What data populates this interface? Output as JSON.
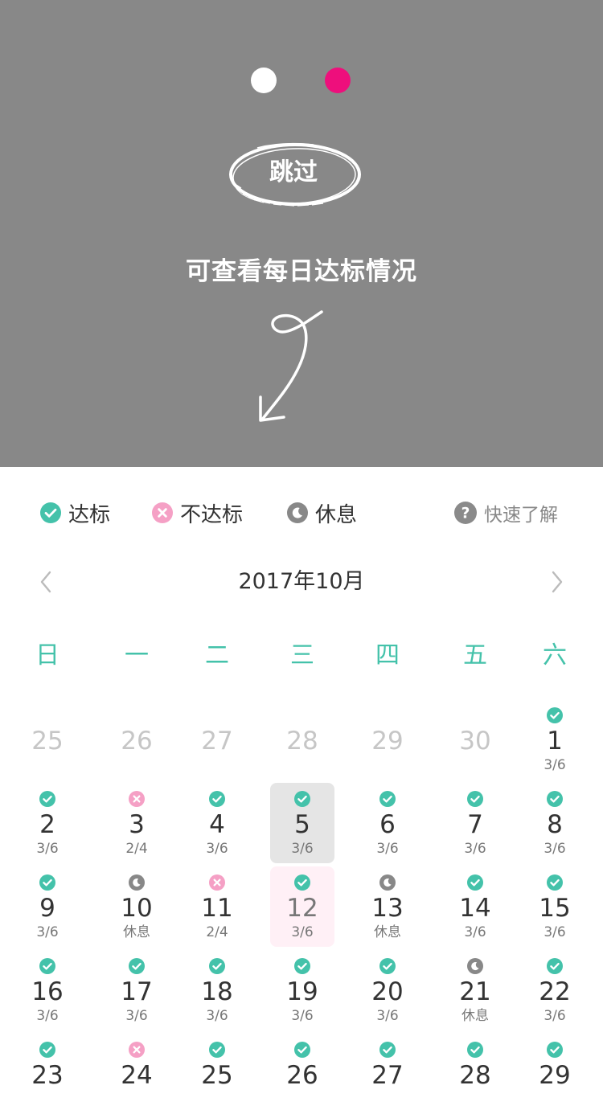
{
  "overlay": {
    "skip_label": "跳过",
    "guide_text": "可查看每日达标情况",
    "colors": {
      "dim": "#888888",
      "active_dot": "#ee0f7c",
      "inactive_dot": "#ffffff"
    }
  },
  "legend": {
    "items": [
      {
        "label": "达标",
        "icon": "check-circle-icon",
        "color": "#44c2aa"
      },
      {
        "label": "不达标",
        "icon": "x-circle-icon",
        "color": "#f5a0c5"
      },
      {
        "label": "休息",
        "icon": "moon-icon",
        "color": "#888888"
      }
    ],
    "help": {
      "label": "快速了解",
      "icon": "question-circle-icon"
    }
  },
  "calendar": {
    "month_title": "2017年10月",
    "weekdays": [
      "日",
      "一",
      "二",
      "三",
      "四",
      "五",
      "六"
    ],
    "days": [
      {
        "d": "25",
        "s": "",
        "st": "",
        "muted": true
      },
      {
        "d": "26",
        "s": "",
        "st": "",
        "muted": true
      },
      {
        "d": "27",
        "s": "",
        "st": "",
        "muted": true
      },
      {
        "d": "28",
        "s": "",
        "st": "",
        "muted": true
      },
      {
        "d": "29",
        "s": "",
        "st": "",
        "muted": true
      },
      {
        "d": "30",
        "s": "",
        "st": "",
        "muted": true
      },
      {
        "d": "1",
        "s": "3/6",
        "st": "ok"
      },
      {
        "d": "2",
        "s": "3/6",
        "st": "ok"
      },
      {
        "d": "3",
        "s": "2/4",
        "st": "fail"
      },
      {
        "d": "4",
        "s": "3/6",
        "st": "ok"
      },
      {
        "d": "5",
        "s": "3/6",
        "st": "ok",
        "selected": true
      },
      {
        "d": "6",
        "s": "3/6",
        "st": "ok"
      },
      {
        "d": "7",
        "s": "3/6",
        "st": "ok"
      },
      {
        "d": "8",
        "s": "3/6",
        "st": "ok"
      },
      {
        "d": "9",
        "s": "3/6",
        "st": "ok"
      },
      {
        "d": "10",
        "s": "休息",
        "st": "rest"
      },
      {
        "d": "11",
        "s": "2/4",
        "st": "fail"
      },
      {
        "d": "12",
        "s": "3/6",
        "st": "ok",
        "today": true
      },
      {
        "d": "13",
        "s": "休息",
        "st": "rest"
      },
      {
        "d": "14",
        "s": "3/6",
        "st": "ok"
      },
      {
        "d": "15",
        "s": "3/6",
        "st": "ok"
      },
      {
        "d": "16",
        "s": "3/6",
        "st": "ok"
      },
      {
        "d": "17",
        "s": "3/6",
        "st": "ok"
      },
      {
        "d": "18",
        "s": "3/6",
        "st": "ok"
      },
      {
        "d": "19",
        "s": "3/6",
        "st": "ok"
      },
      {
        "d": "20",
        "s": "3/6",
        "st": "ok"
      },
      {
        "d": "21",
        "s": "休息",
        "st": "rest"
      },
      {
        "d": "22",
        "s": "3/6",
        "st": "ok"
      },
      {
        "d": "23",
        "s": "",
        "st": "ok"
      },
      {
        "d": "24",
        "s": "",
        "st": "fail"
      },
      {
        "d": "25",
        "s": "",
        "st": "ok"
      },
      {
        "d": "26",
        "s": "",
        "st": "ok"
      },
      {
        "d": "27",
        "s": "",
        "st": "ok"
      },
      {
        "d": "28",
        "s": "",
        "st": "ok"
      },
      {
        "d": "29",
        "s": "",
        "st": "ok"
      }
    ]
  }
}
